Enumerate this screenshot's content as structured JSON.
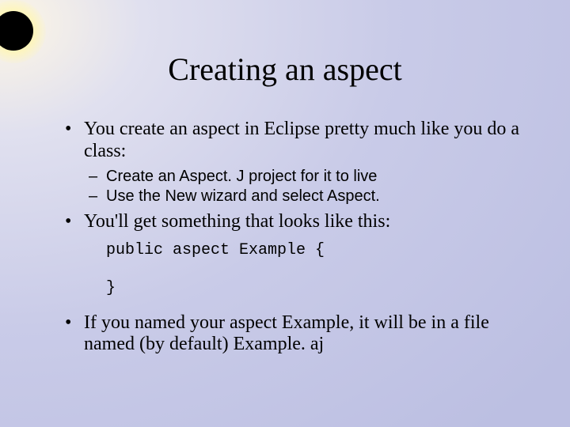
{
  "title": "Creating an aspect",
  "bullets": {
    "b1": "You create an aspect in Eclipse pretty much like you do a class:",
    "b1_sub1": "Create an Aspect. J project for it to live",
    "b1_sub2": "Use the New wizard and select Aspect.",
    "b2": "You'll get something that looks like this:",
    "code_line1": "public aspect Example {",
    "code_blank": " ",
    "code_line2": "}",
    "b3": "If you named your aspect Example, it will be in a file named (by default) Example. aj"
  }
}
